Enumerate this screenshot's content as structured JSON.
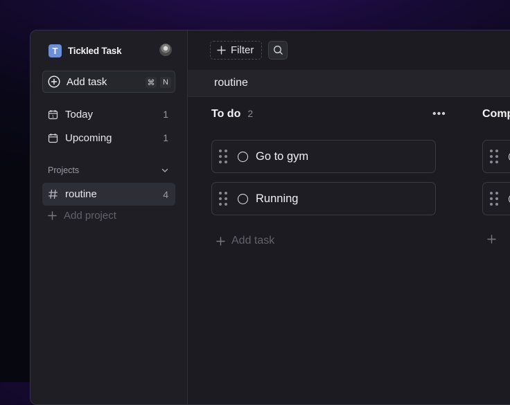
{
  "app": {
    "name": "Tickled Task",
    "logo_letter": "T"
  },
  "sidebar": {
    "add_task": {
      "label": "Add task",
      "shortcut_mod": "⌘",
      "shortcut_key": "N"
    },
    "nav": [
      {
        "label": "Today",
        "count": "1",
        "icon": "calendar-today-icon"
      },
      {
        "label": "Upcoming",
        "count": "1",
        "icon": "calendar-icon"
      }
    ],
    "projects_label": "Projects",
    "projects": [
      {
        "label": "routine",
        "count": "4",
        "icon": "hash-icon"
      }
    ],
    "add_project_label": "Add project"
  },
  "toolbar": {
    "filter_label": "Filter"
  },
  "project": {
    "title": "routine"
  },
  "columns": [
    {
      "name": "To do",
      "count": "2",
      "tasks": [
        {
          "label": "Go to gym"
        },
        {
          "label": "Running"
        }
      ],
      "add_label": "Add task"
    },
    {
      "name": "Comp"
    }
  ],
  "colors": {
    "accent": "#6d8fd6",
    "background": "#1b1b21",
    "sidebar": "#1e1e24"
  }
}
